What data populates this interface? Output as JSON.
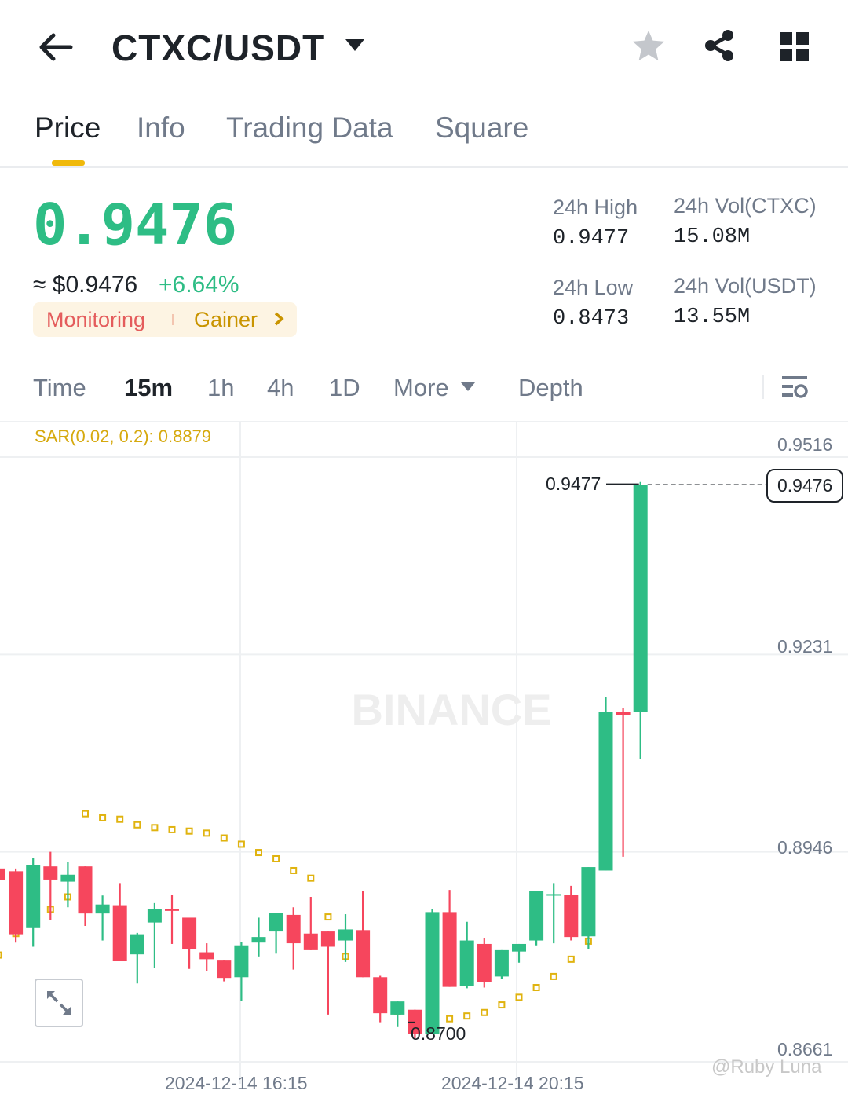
{
  "header": {
    "pair": "CTXC/USDT",
    "icons": [
      "back-arrow-icon",
      "caret-down-icon",
      "star-icon",
      "share-icon",
      "grid-menu-icon"
    ]
  },
  "tabs": [
    {
      "label": "Price",
      "active": true
    },
    {
      "label": "Info",
      "active": false
    },
    {
      "label": "Trading Data",
      "active": false
    },
    {
      "label": "Square",
      "active": false
    }
  ],
  "ticker": {
    "last_price": "0.9476",
    "approx_usd": "≈ $0.9476",
    "change_pct": "+6.64%",
    "tag_monitoring": "Monitoring",
    "tag_gainer": "Gainer",
    "stats": {
      "high_label": "24h High",
      "high_value": "0.9477",
      "low_label": "24h Low",
      "low_value": "0.8473",
      "vol_base_label": "24h Vol(CTXC)",
      "vol_base_value": "15.08M",
      "vol_quote_label": "24h Vol(USDT)",
      "vol_quote_value": "13.55M"
    }
  },
  "intervals": {
    "items": [
      "Time",
      "15m",
      "1h",
      "4h",
      "1D",
      "More",
      "Depth"
    ],
    "active": "15m"
  },
  "chart_data": {
    "type": "candlestick",
    "indicator_label": "SAR(0.02, 0.2): 0.8879",
    "y_ticks": [
      "0.9516",
      "0.9231",
      "0.8946",
      "0.8661"
    ],
    "x_ticks": [
      "2024-12-14 16:15",
      "2024-12-14 20:15"
    ],
    "ylim": [
      0.8661,
      0.9516
    ],
    "current_price": "0.9476",
    "high_marker": "0.9477",
    "low_marker": "0.8700",
    "watermark": "BINANCE",
    "candles": [
      {
        "o": 0.8922,
        "h": 0.8936,
        "l": 0.8889,
        "c": 0.8905
      },
      {
        "o": 0.8918,
        "h": 0.8922,
        "l": 0.8815,
        "c": 0.8827
      },
      {
        "o": 0.8837,
        "h": 0.8937,
        "l": 0.8809,
        "c": 0.8927
      },
      {
        "o": 0.8925,
        "h": 0.8946,
        "l": 0.8847,
        "c": 0.8906
      },
      {
        "o": 0.8903,
        "h": 0.8932,
        "l": 0.8866,
        "c": 0.8913
      },
      {
        "o": 0.8925,
        "h": 0.8925,
        "l": 0.8839,
        "c": 0.8857
      },
      {
        "o": 0.8857,
        "h": 0.8883,
        "l": 0.8818,
        "c": 0.887
      },
      {
        "o": 0.8869,
        "h": 0.8901,
        "l": 0.8795,
        "c": 0.8788
      },
      {
        "o": 0.8798,
        "h": 0.8829,
        "l": 0.8756,
        "c": 0.8827
      },
      {
        "o": 0.8844,
        "h": 0.8872,
        "l": 0.8778,
        "c": 0.8863
      },
      {
        "o": 0.8863,
        "h": 0.8884,
        "l": 0.8813,
        "c": 0.8861
      },
      {
        "o": 0.8851,
        "h": 0.8851,
        "l": 0.8777,
        "c": 0.8805
      },
      {
        "o": 0.8801,
        "h": 0.8814,
        "l": 0.8774,
        "c": 0.8791
      },
      {
        "o": 0.8789,
        "h": 0.8789,
        "l": 0.8759,
        "c": 0.8764
      },
      {
        "o": 0.8765,
        "h": 0.8816,
        "l": 0.8731,
        "c": 0.8811
      },
      {
        "o": 0.8815,
        "h": 0.8851,
        "l": 0.8795,
        "c": 0.8823
      },
      {
        "o": 0.8831,
        "h": 0.8858,
        "l": 0.8799,
        "c": 0.8858
      },
      {
        "o": 0.8855,
        "h": 0.8866,
        "l": 0.8776,
        "c": 0.8814
      },
      {
        "o": 0.8828,
        "h": 0.8881,
        "l": 0.8805,
        "c": 0.8804
      },
      {
        "o": 0.8831,
        "h": 0.8831,
        "l": 0.8711,
        "c": 0.8809
      },
      {
        "o": 0.8818,
        "h": 0.8856,
        "l": 0.8787,
        "c": 0.8834
      },
      {
        "o": 0.8833,
        "h": 0.889,
        "l": 0.8768,
        "c": 0.8765
      },
      {
        "o": 0.8765,
        "h": 0.8767,
        "l": 0.87,
        "c": 0.8713
      },
      {
        "o": 0.8711,
        "h": 0.8727,
        "l": 0.8693,
        "c": 0.873
      },
      {
        "o": 0.8718,
        "h": 0.869,
        "l": 0.8677,
        "c": 0.8683
      },
      {
        "o": 0.8683,
        "h": 0.8864,
        "l": 0.8683,
        "c": 0.8859
      },
      {
        "o": 0.8859,
        "h": 0.8891,
        "l": 0.8807,
        "c": 0.8751
      },
      {
        "o": 0.8752,
        "h": 0.8845,
        "l": 0.8749,
        "c": 0.8818
      },
      {
        "o": 0.8813,
        "h": 0.8822,
        "l": 0.875,
        "c": 0.8758
      },
      {
        "o": 0.8766,
        "h": 0.8804,
        "l": 0.8763,
        "c": 0.8804
      },
      {
        "o": 0.8802,
        "h": 0.8812,
        "l": 0.8786,
        "c": 0.8813
      },
      {
        "o": 0.8818,
        "h": 0.8883,
        "l": 0.8811,
        "c": 0.8889
      },
      {
        "o": 0.8883,
        "h": 0.8901,
        "l": 0.8814,
        "c": 0.8885
      },
      {
        "o": 0.8884,
        "h": 0.8897,
        "l": 0.8818,
        "c": 0.8823
      },
      {
        "o": 0.8824,
        "h": 0.8911,
        "l": 0.8805,
        "c": 0.8924
      },
      {
        "o": 0.8919,
        "h": 0.917,
        "l": 0.8919,
        "c": 0.9148
      },
      {
        "o": 0.9148,
        "h": 0.9154,
        "l": 0.8939,
        "c": 0.9143
      },
      {
        "o": 0.9148,
        "h": 0.948,
        "l": 0.908,
        "c": 0.9476
      }
    ],
    "sar": [
      0.8797,
      0.8828,
      0.8853,
      0.8863,
      0.8881,
      0.9001,
      0.8995,
      0.8993,
      0.8985,
      0.8981,
      0.8978,
      0.8976,
      0.8973,
      0.8966,
      0.8957,
      0.8945,
      0.8936,
      0.8919,
      0.8908,
      0.8852,
      0.8795,
      0.8779,
      0.8739,
      0.8716,
      0.8704,
      0.87,
      0.8705,
      0.8709,
      0.8714,
      0.8725,
      0.8736,
      0.875,
      0.8766,
      0.8791,
      0.8817
    ]
  },
  "credit": "@Ruby Luna"
}
